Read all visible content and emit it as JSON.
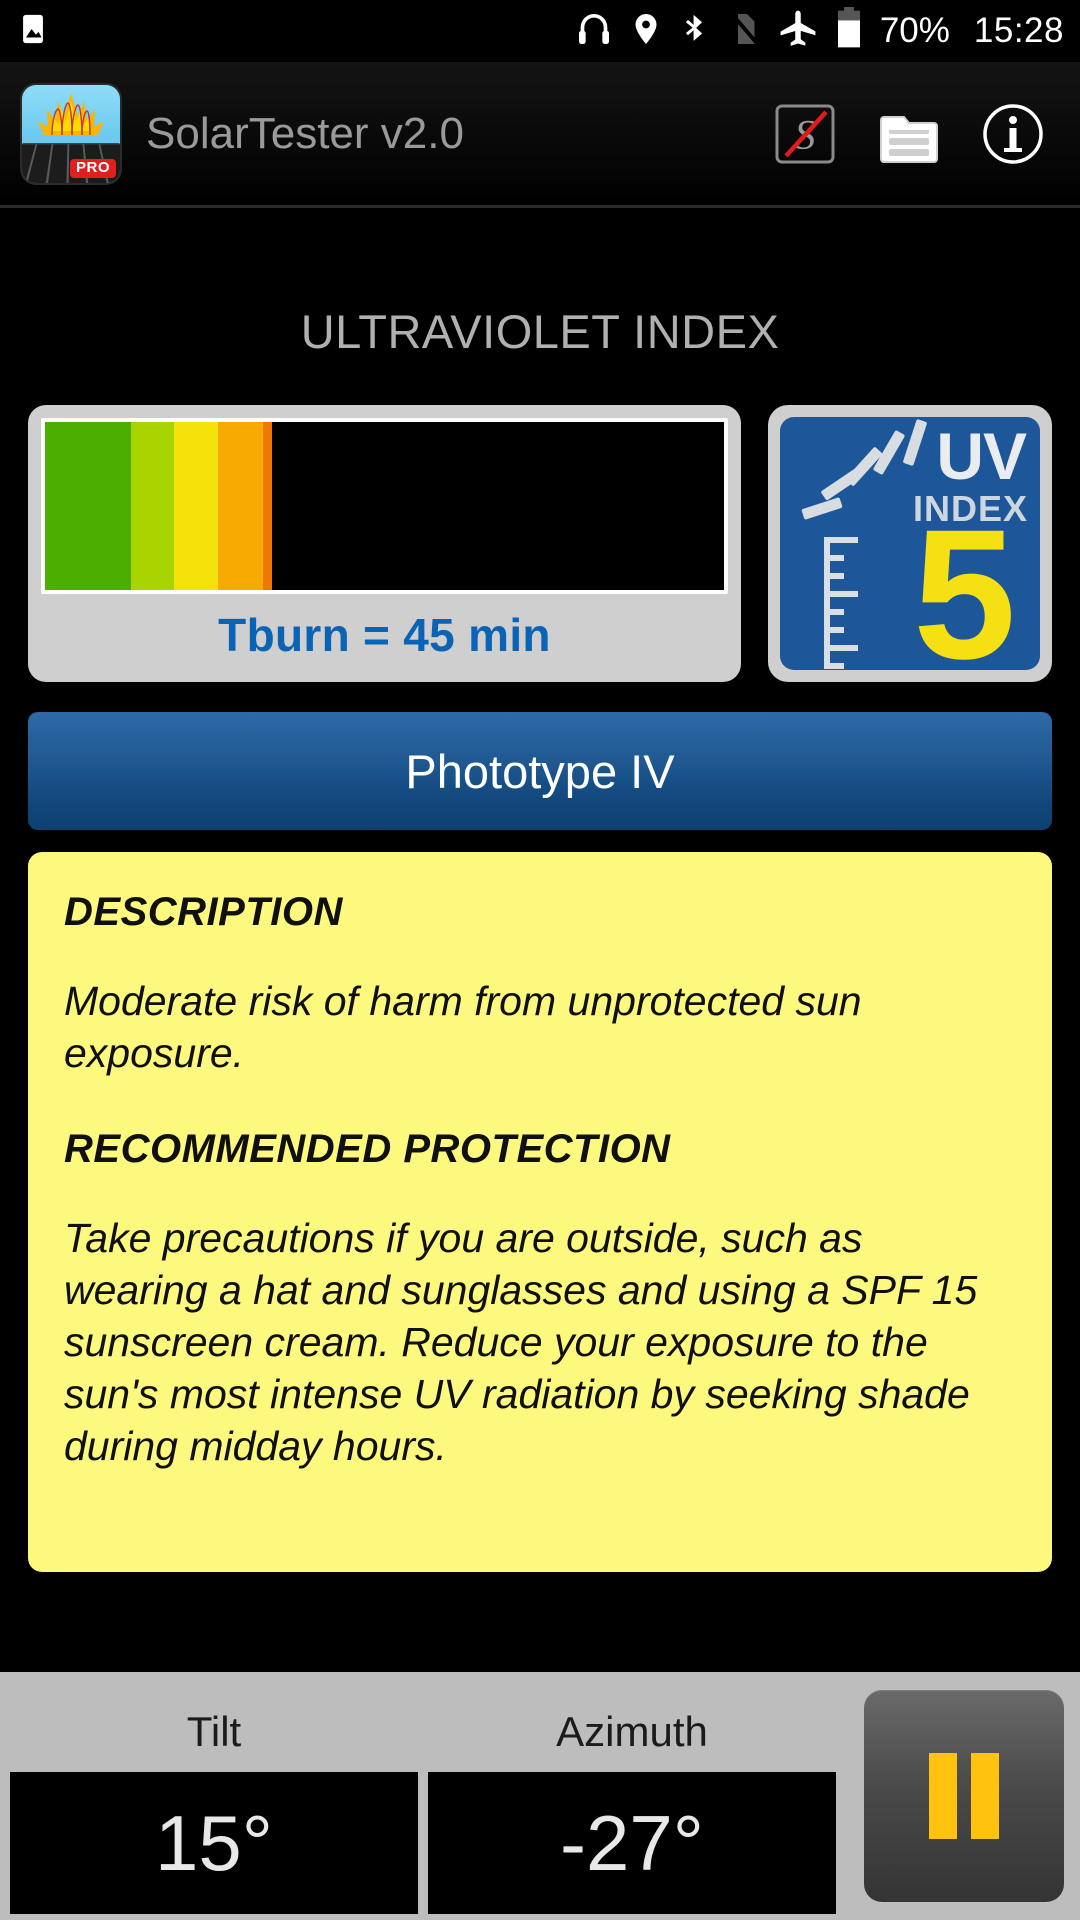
{
  "statusbar": {
    "time": "15:28",
    "battery_percent": "70%",
    "icons": [
      "image-icon",
      "headphones-icon",
      "location-pin-icon",
      "bluetooth-icon",
      "no-sim-icon",
      "airplane-mode-icon",
      "battery-icon"
    ]
  },
  "appbar": {
    "title": "SolarTester v2.0",
    "logo_badge": "PRO",
    "actions": [
      "sensor-disabled-icon",
      "document-list-icon",
      "info-icon"
    ]
  },
  "main": {
    "section_title": "ULTRAVIOLET INDEX",
    "tburn": "Tburn = 45 min",
    "phototype": "Phototype IV",
    "uv_badge": {
      "title": "UV",
      "subtitle": "INDEX",
      "value": "5"
    },
    "uv_bar": {
      "segments": [
        {
          "color": "#4caf00",
          "width_pct": 12.6
        },
        {
          "color": "#a8d400",
          "width_pct": 6.4
        },
        {
          "color": "#f5e20a",
          "width_pct": 6.5
        },
        {
          "color": "#f7ab00",
          "width_pct": 6.6
        },
        {
          "color": "#f07800",
          "width_pct": 1.4
        },
        {
          "color": "#000000",
          "width_pct": 66.5
        }
      ]
    },
    "description": {
      "heading": "DESCRIPTION",
      "body": "Moderate risk of harm from unprotected sun exposure.",
      "heading2": "RECOMMENDED PROTECTION",
      "body2": "Take precautions if you are outside, such as wearing a hat and sunglasses and using a SPF 15 sunscreen cream. Reduce your exposure to the sun's most intense UV radiation by seeking shade during midday hours."
    }
  },
  "bottombar": {
    "tilt_label": "Tilt",
    "tilt_value": "15°",
    "azimuth_label": "Azimuth",
    "azimuth_value": "-27°",
    "pause_button": "pause-icon"
  },
  "colors": {
    "accent_blue": "#0a63b5",
    "panel_yellow": "#fcf97e",
    "badge_blue": "#1e5799",
    "badge_number_yellow": "#f5e013",
    "pause_yellow": "#ffc20e"
  }
}
